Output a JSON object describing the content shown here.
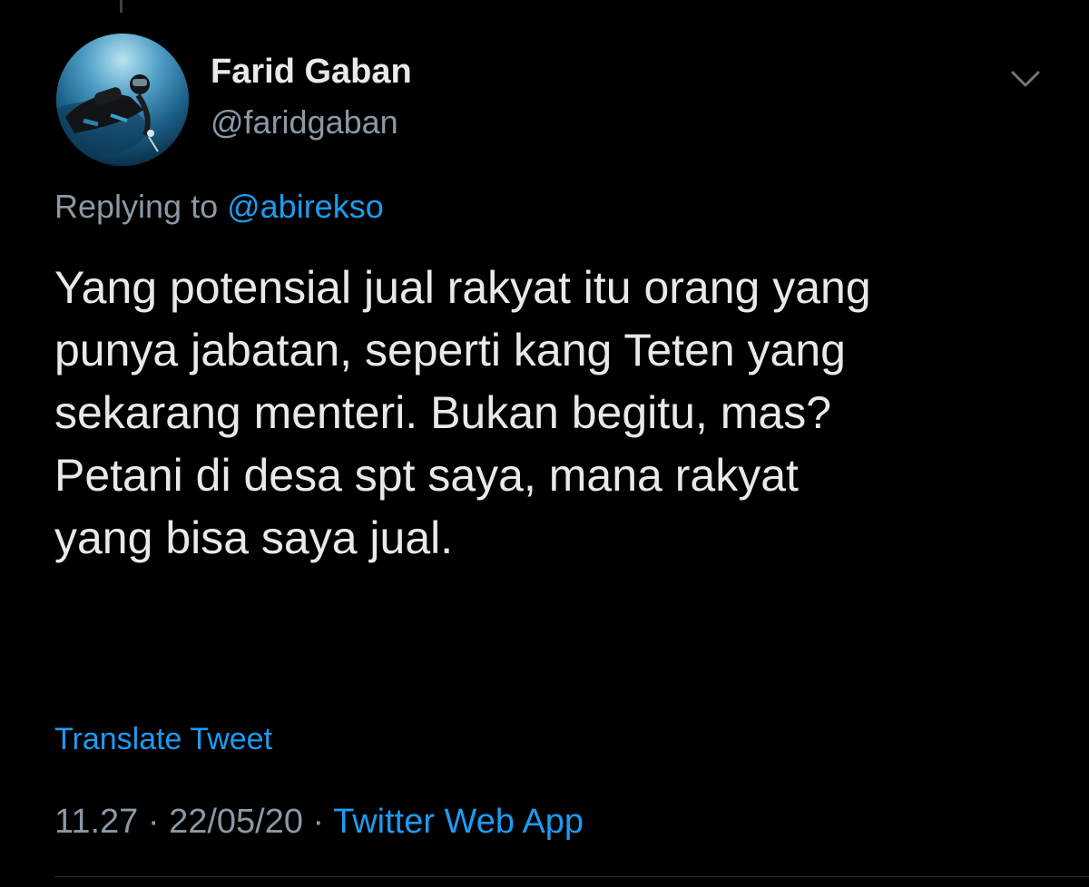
{
  "tweet": {
    "author": {
      "display_name": "Farid Gaban",
      "handle": "@faridgaban"
    },
    "reply": {
      "prefix": "Replying to ",
      "mention": "@abirekso"
    },
    "text_lines": [
      "Yang potensial jual rakyat itu orang yang",
      "punya jabatan, seperti kang Teten yang",
      "sekarang menteri. Bukan begitu, mas?",
      "Petani di desa spt saya, mana rakyat",
      "yang bisa saya jual."
    ],
    "translate_label": "Translate Tweet",
    "time": "11.27",
    "separator": " · ",
    "date": "22/05/20",
    "source": "Twitter Web App"
  },
  "icons": {
    "more_menu": "chevron-down-icon"
  },
  "colors": {
    "background": "#000000",
    "primary_text": "#e7e9ea",
    "secondary_text": "#8b98a5",
    "link": "#1d9bf0"
  }
}
